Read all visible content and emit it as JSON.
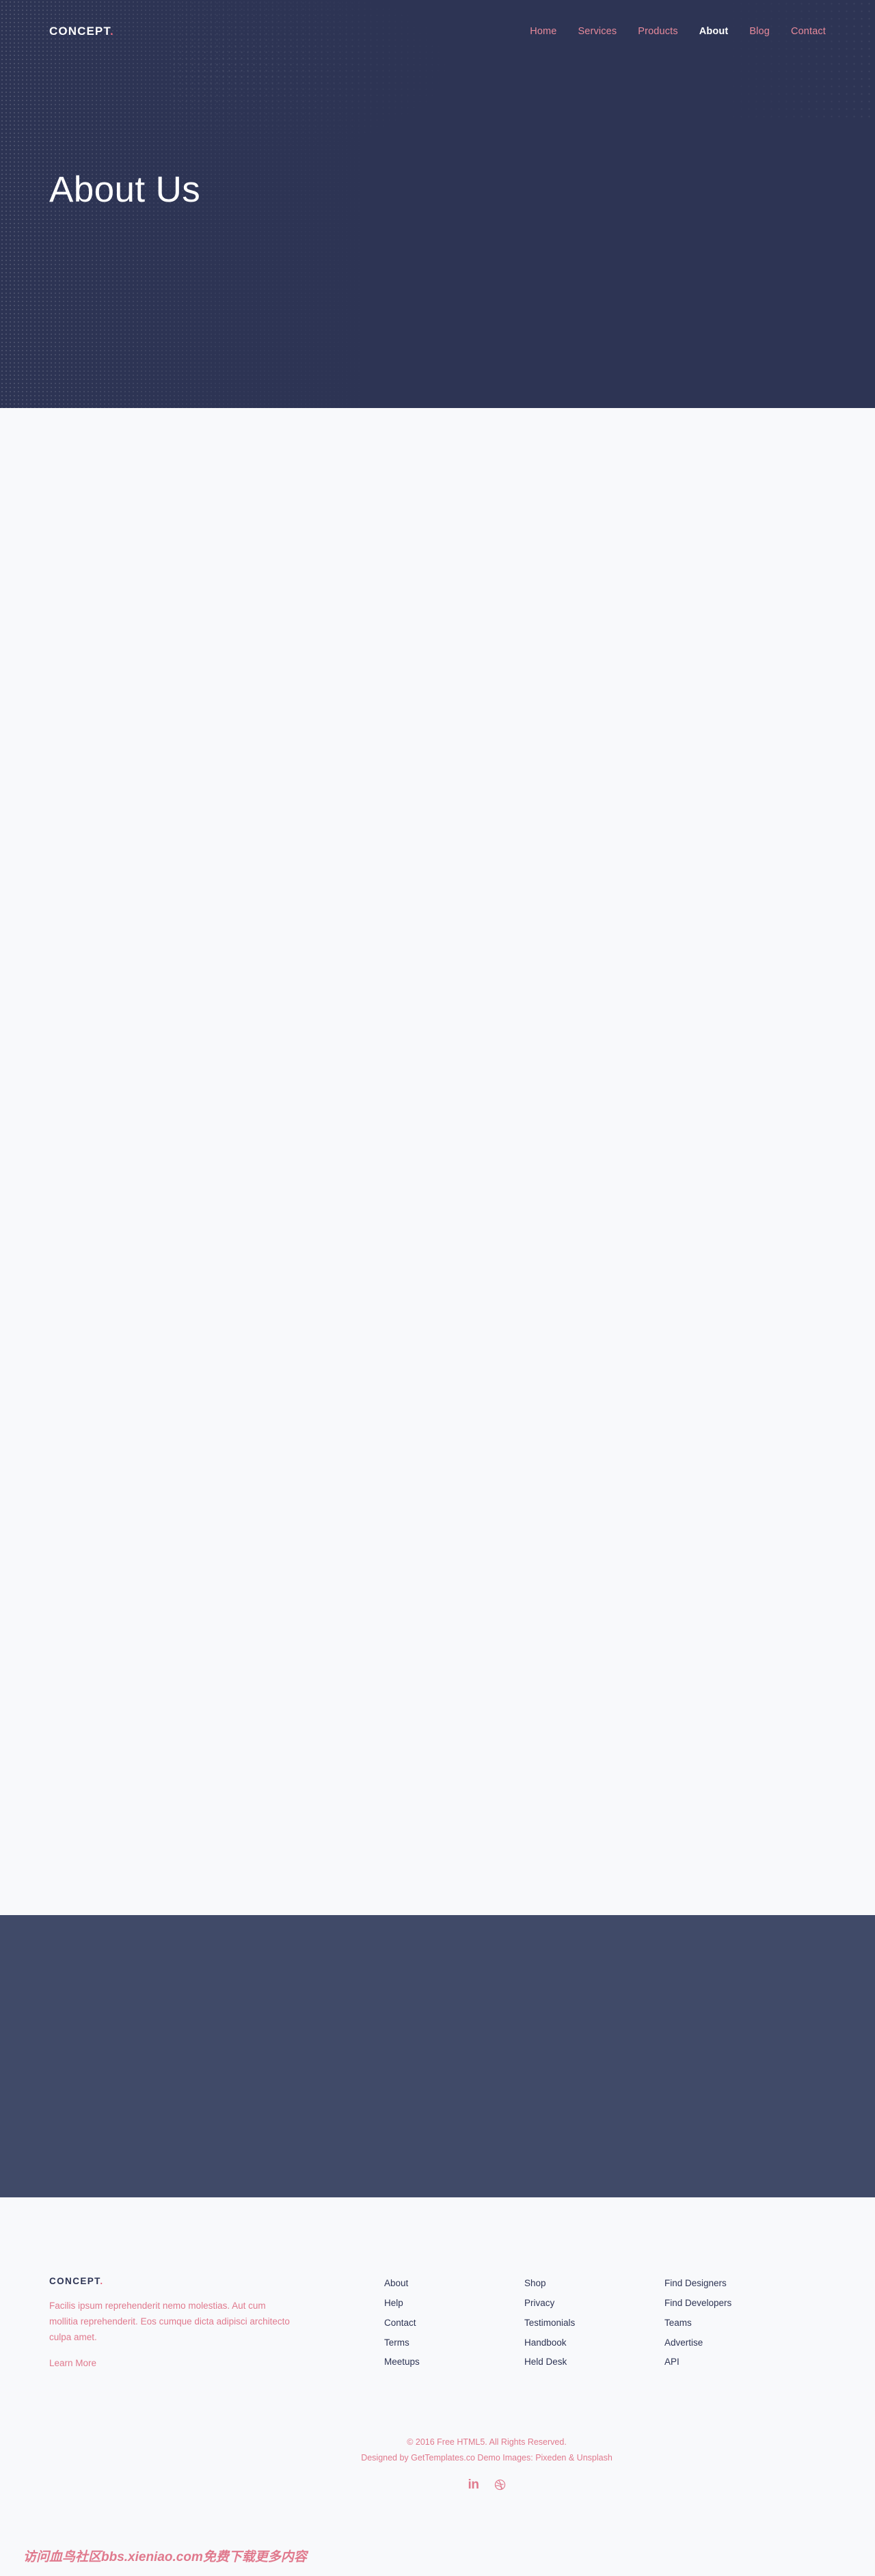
{
  "theme": {
    "hero_bg": "#2d3454",
    "band_bg": "#404a68",
    "page_bg": "#f8f9fb",
    "accent_pink": "#e0798d",
    "nav_pink": "#e78a9b",
    "navy_text": "#2d3454"
  },
  "header": {
    "brand": "CONCEPT",
    "brand_dot": ".",
    "nav": [
      {
        "label": "Home",
        "active": false
      },
      {
        "label": "Services",
        "active": false
      },
      {
        "label": "Products",
        "active": false
      },
      {
        "label": "About",
        "active": true
      },
      {
        "label": "Blog",
        "active": false
      },
      {
        "label": "Contact",
        "active": false
      }
    ]
  },
  "hero": {
    "title": "About Us"
  },
  "footer": {
    "logo": "CONCEPT",
    "logo_dot": ".",
    "description": "Facilis ipsum reprehenderit nemo molestias. Aut cum mollitia reprehenderit. Eos cumque dicta adipisci architecto culpa amet.",
    "learn_more": "Learn More",
    "columns": [
      {
        "links": [
          "About",
          "Help",
          "Contact",
          "Terms",
          "Meetups"
        ]
      },
      {
        "links": [
          "Shop",
          "Privacy",
          "Testimonials",
          "Handbook",
          "Held Desk"
        ]
      },
      {
        "links": [
          "Find Designers",
          "Find Developers",
          "Teams",
          "Advertise",
          "API"
        ]
      }
    ]
  },
  "copyright": {
    "line1": "© 2016 Free HTML5. All Rights Reserved.",
    "line2_prefix": "Designed by ",
    "line2_link1": "GetTemplates.co",
    "line2_middle": " Demo Images: ",
    "line2_link2": "Pixeden",
    "line2_amp": " & ",
    "line2_link3": "Unsplash"
  },
  "social": [
    {
      "name": "linkedin",
      "glyph": "in"
    },
    {
      "name": "dribbble",
      "glyph": ""
    }
  ],
  "watermark": {
    "text": "访问血鸟社区bbs.xieniao.com免费下载更多内容"
  }
}
